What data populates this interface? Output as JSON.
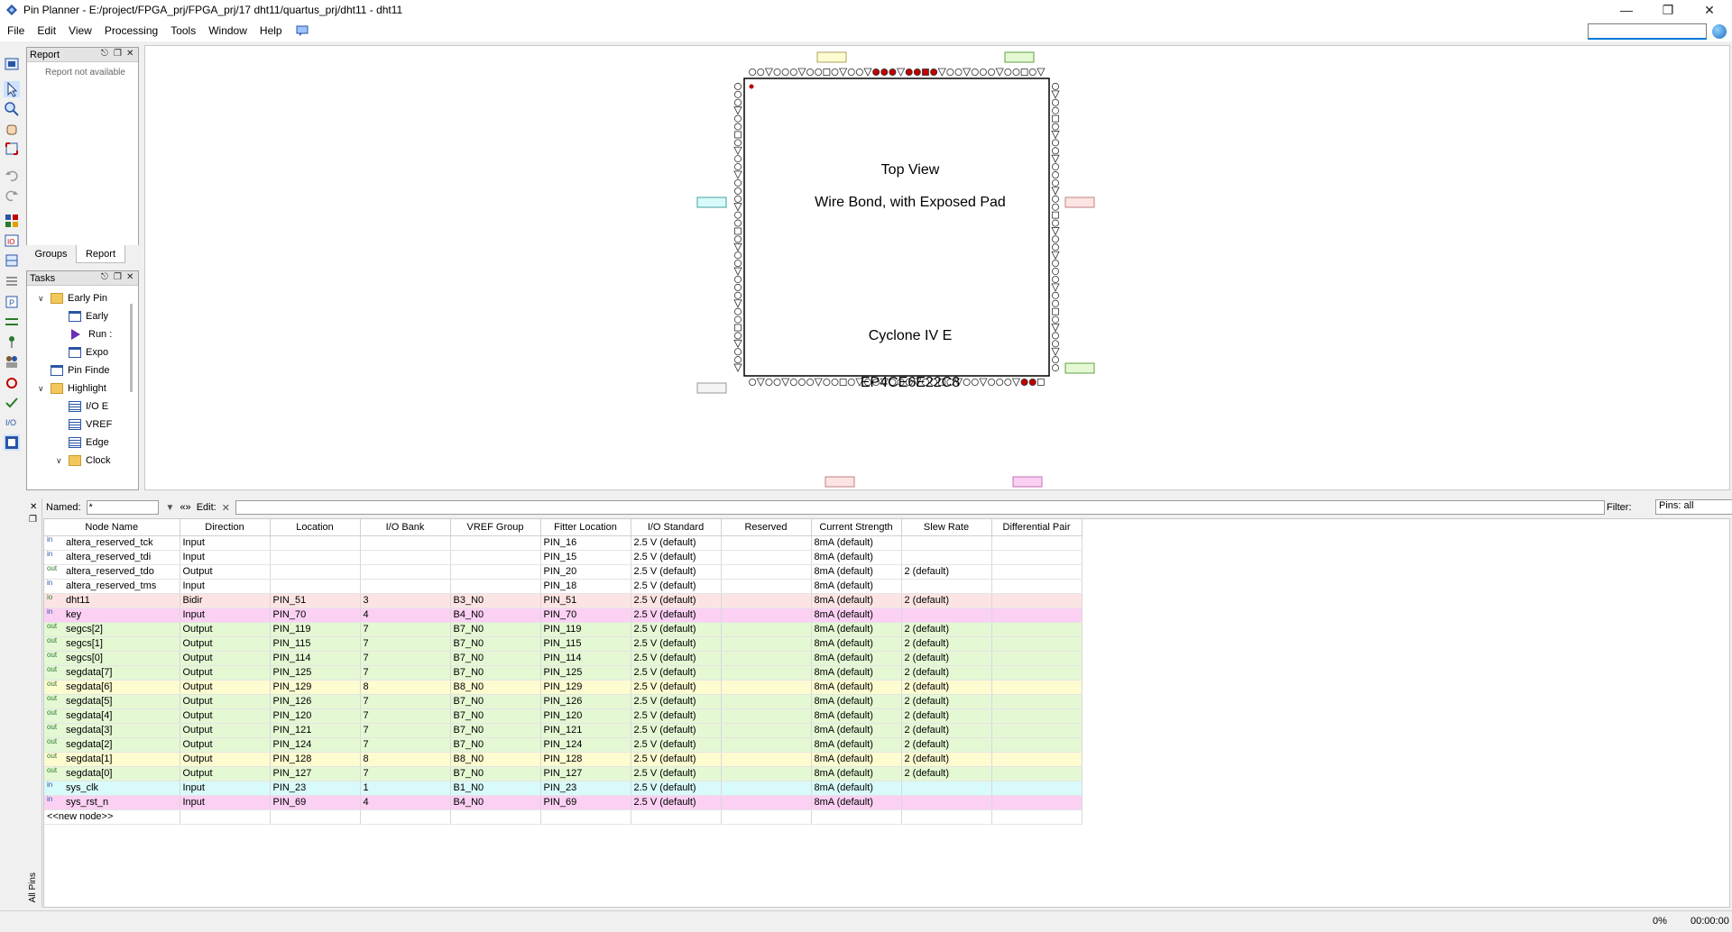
{
  "window": {
    "title": "Pin Planner - E:/project/FPGA_prj/FPGA_prj/17 dht11/quartus_prj/dht11 - dht11"
  },
  "menu": [
    "File",
    "Edit",
    "View",
    "Processing",
    "Tools",
    "Window",
    "Help"
  ],
  "report_panel": {
    "title": "Report",
    "message": "Report not available"
  },
  "panel_tabs": [
    "Groups",
    "Report"
  ],
  "tasks_panel": {
    "title": "Tasks",
    "items": [
      "Early Pin",
      "Early",
      "Run :",
      "Expo",
      "Pin Finde",
      "Highlight",
      "I/O E",
      "VREF",
      "Edge",
      "Clock"
    ]
  },
  "package_view": {
    "title": "Top View",
    "subtitle": "Wire Bond, with Exposed Pad",
    "family": "Cyclone IV E",
    "device": "EP4CE6E22C8",
    "pins_per_side": 36,
    "accent": "#c00000"
  },
  "pin_toolbar": {
    "named_label": "Named:",
    "named_value": "*",
    "more_label": "«»",
    "edit_label": "Edit:",
    "filter_label": "Filter:",
    "filter_value": "Pins: all"
  },
  "side_label": "All Pins",
  "pin_table": {
    "columns": [
      "Node Name",
      "Direction",
      "Location",
      "I/O Bank",
      "VREF Group",
      "Fitter Location",
      "I/O Standard",
      "Reserved",
      "Current Strength",
      "Slew Rate",
      "Differential Pair"
    ],
    "rows": [
      {
        "icon": "in",
        "name": "altera_reserved_tck",
        "dir": "Input",
        "loc": "",
        "bank": "",
        "vref": "",
        "fit": "PIN_16",
        "std": "2.5 V (default)",
        "res": "",
        "cur": "8mA (default)",
        "slew": "",
        "diff": "",
        "color": "white"
      },
      {
        "icon": "in",
        "name": "altera_reserved_tdi",
        "dir": "Input",
        "loc": "",
        "bank": "",
        "vref": "",
        "fit": "PIN_15",
        "std": "2.5 V (default)",
        "res": "",
        "cur": "8mA (default)",
        "slew": "",
        "diff": "",
        "color": "white"
      },
      {
        "icon": "out",
        "name": "altera_reserved_tdo",
        "dir": "Output",
        "loc": "",
        "bank": "",
        "vref": "",
        "fit": "PIN_20",
        "std": "2.5 V (default)",
        "res": "",
        "cur": "8mA (default)",
        "slew": "2 (default)",
        "diff": "",
        "color": "white"
      },
      {
        "icon": "in",
        "name": "altera_reserved_tms",
        "dir": "Input",
        "loc": "",
        "bank": "",
        "vref": "",
        "fit": "PIN_18",
        "std": "2.5 V (default)",
        "res": "",
        "cur": "8mA (default)",
        "slew": "",
        "diff": "",
        "color": "white"
      },
      {
        "icon": "io",
        "name": "dht11",
        "dir": "Bidir",
        "loc": "PIN_51",
        "bank": "3",
        "vref": "B3_N0",
        "fit": "PIN_51",
        "std": "2.5 V (default)",
        "res": "",
        "cur": "8mA (default)",
        "slew": "2 (default)",
        "diff": "",
        "color": "pink"
      },
      {
        "icon": "in",
        "name": "key",
        "dir": "Input",
        "loc": "PIN_70",
        "bank": "4",
        "vref": "B4_N0",
        "fit": "PIN_70",
        "std": "2.5 V (default)",
        "res": "",
        "cur": "8mA (default)",
        "slew": "",
        "diff": "",
        "color": "magenta"
      },
      {
        "icon": "out",
        "name": "segcs[2]",
        "dir": "Output",
        "loc": "PIN_119",
        "bank": "7",
        "vref": "B7_N0",
        "fit": "PIN_119",
        "std": "2.5 V (default)",
        "res": "",
        "cur": "8mA (default)",
        "slew": "2 (default)",
        "diff": "",
        "color": "green"
      },
      {
        "icon": "out",
        "name": "segcs[1]",
        "dir": "Output",
        "loc": "PIN_115",
        "bank": "7",
        "vref": "B7_N0",
        "fit": "PIN_115",
        "std": "2.5 V (default)",
        "res": "",
        "cur": "8mA (default)",
        "slew": "2 (default)",
        "diff": "",
        "color": "green"
      },
      {
        "icon": "out",
        "name": "segcs[0]",
        "dir": "Output",
        "loc": "PIN_114",
        "bank": "7",
        "vref": "B7_N0",
        "fit": "PIN_114",
        "std": "2.5 V (default)",
        "res": "",
        "cur": "8mA (default)",
        "slew": "2 (default)",
        "diff": "",
        "color": "green"
      },
      {
        "icon": "out",
        "name": "segdata[7]",
        "dir": "Output",
        "loc": "PIN_125",
        "bank": "7",
        "vref": "B7_N0",
        "fit": "PIN_125",
        "std": "2.5 V (default)",
        "res": "",
        "cur": "8mA (default)",
        "slew": "2 (default)",
        "diff": "",
        "color": "green"
      },
      {
        "icon": "out",
        "name": "segdata[6]",
        "dir": "Output",
        "loc": "PIN_129",
        "bank": "8",
        "vref": "B8_N0",
        "fit": "PIN_129",
        "std": "2.5 V (default)",
        "res": "",
        "cur": "8mA (default)",
        "slew": "2 (default)",
        "diff": "",
        "color": "yellow"
      },
      {
        "icon": "out",
        "name": "segdata[5]",
        "dir": "Output",
        "loc": "PIN_126",
        "bank": "7",
        "vref": "B7_N0",
        "fit": "PIN_126",
        "std": "2.5 V (default)",
        "res": "",
        "cur": "8mA (default)",
        "slew": "2 (default)",
        "diff": "",
        "color": "green"
      },
      {
        "icon": "out",
        "name": "segdata[4]",
        "dir": "Output",
        "loc": "PIN_120",
        "bank": "7",
        "vref": "B7_N0",
        "fit": "PIN_120",
        "std": "2.5 V (default)",
        "res": "",
        "cur": "8mA (default)",
        "slew": "2 (default)",
        "diff": "",
        "color": "green"
      },
      {
        "icon": "out",
        "name": "segdata[3]",
        "dir": "Output",
        "loc": "PIN_121",
        "bank": "7",
        "vref": "B7_N0",
        "fit": "PIN_121",
        "std": "2.5 V (default)",
        "res": "",
        "cur": "8mA (default)",
        "slew": "2 (default)",
        "diff": "",
        "color": "green"
      },
      {
        "icon": "out",
        "name": "segdata[2]",
        "dir": "Output",
        "loc": "PIN_124",
        "bank": "7",
        "vref": "B7_N0",
        "fit": "PIN_124",
        "std": "2.5 V (default)",
        "res": "",
        "cur": "8mA (default)",
        "slew": "2 (default)",
        "diff": "",
        "color": "green"
      },
      {
        "icon": "out",
        "name": "segdata[1]",
        "dir": "Output",
        "loc": "PIN_128",
        "bank": "8",
        "vref": "B8_N0",
        "fit": "PIN_128",
        "std": "2.5 V (default)",
        "res": "",
        "cur": "8mA (default)",
        "slew": "2 (default)",
        "diff": "",
        "color": "yellow"
      },
      {
        "icon": "out",
        "name": "segdata[0]",
        "dir": "Output",
        "loc": "PIN_127",
        "bank": "7",
        "vref": "B7_N0",
        "fit": "PIN_127",
        "std": "2.5 V (default)",
        "res": "",
        "cur": "8mA (default)",
        "slew": "2 (default)",
        "diff": "",
        "color": "green"
      },
      {
        "icon": "in",
        "name": "sys_clk",
        "dir": "Input",
        "loc": "PIN_23",
        "bank": "1",
        "vref": "B1_N0",
        "fit": "PIN_23",
        "std": "2.5 V (default)",
        "res": "",
        "cur": "8mA (default)",
        "slew": "",
        "diff": "",
        "color": "cyan"
      },
      {
        "icon": "in",
        "name": "sys_rst_n",
        "dir": "Input",
        "loc": "PIN_69",
        "bank": "4",
        "vref": "B4_N0",
        "fit": "PIN_69",
        "std": "2.5 V (default)",
        "res": "",
        "cur": "8mA (default)",
        "slew": "",
        "diff": "",
        "color": "magenta"
      }
    ],
    "new_node": "<<new node>>"
  },
  "status": {
    "progress": "0%",
    "elapsed": "00:00:00"
  }
}
